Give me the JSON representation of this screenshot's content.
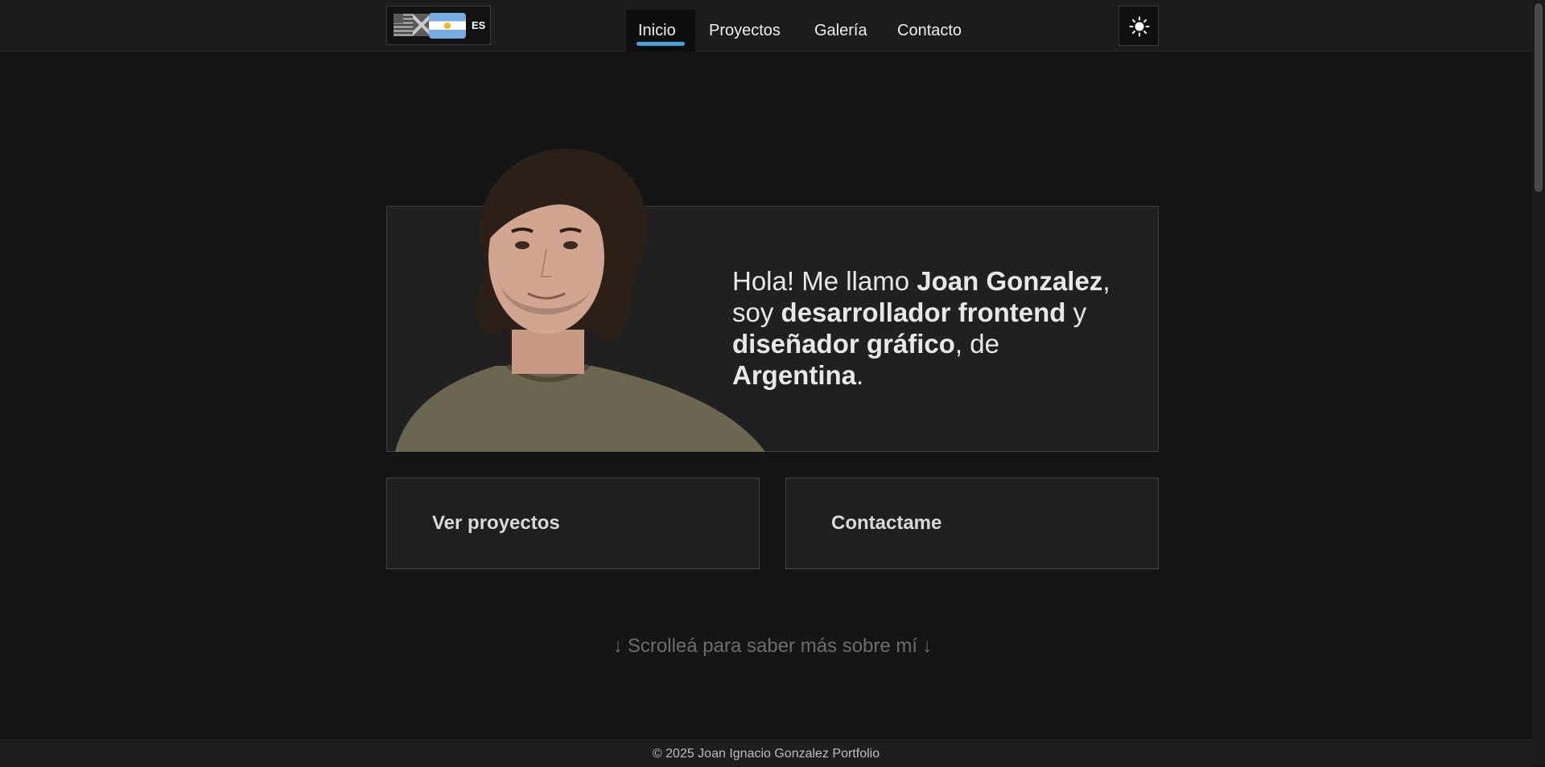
{
  "header": {
    "language": {
      "code": "ES",
      "flags": [
        "us-flag",
        "uk-flag",
        "argentina-flag"
      ]
    },
    "nav": [
      {
        "label": "Inicio",
        "active": true
      },
      {
        "label": "Proyectos",
        "active": false
      },
      {
        "label": "Galería",
        "active": false
      },
      {
        "label": "Contacto",
        "active": false
      }
    ],
    "theme_toggle_icon": "sun-icon",
    "accent_color": "#4aa3df"
  },
  "hero": {
    "p1": "Hola! Me llamo ",
    "name": "Joan Gonzalez",
    "p2": ",",
    "p3": "soy ",
    "role1": "desarrollador frontend",
    "p4": " y",
    "role2": "diseñador gráfico",
    "p5": ", de",
    "country": "Argentina",
    "p6": "."
  },
  "buttons": {
    "projects": "Ver proyectos",
    "contact": "Contactame"
  },
  "scroll_hint": {
    "text": "Scrolleá para saber más sobre mí",
    "arrow": "↓"
  },
  "footer": {
    "text": "© 2025 Joan Ignacio Gonzalez Portfolio"
  }
}
